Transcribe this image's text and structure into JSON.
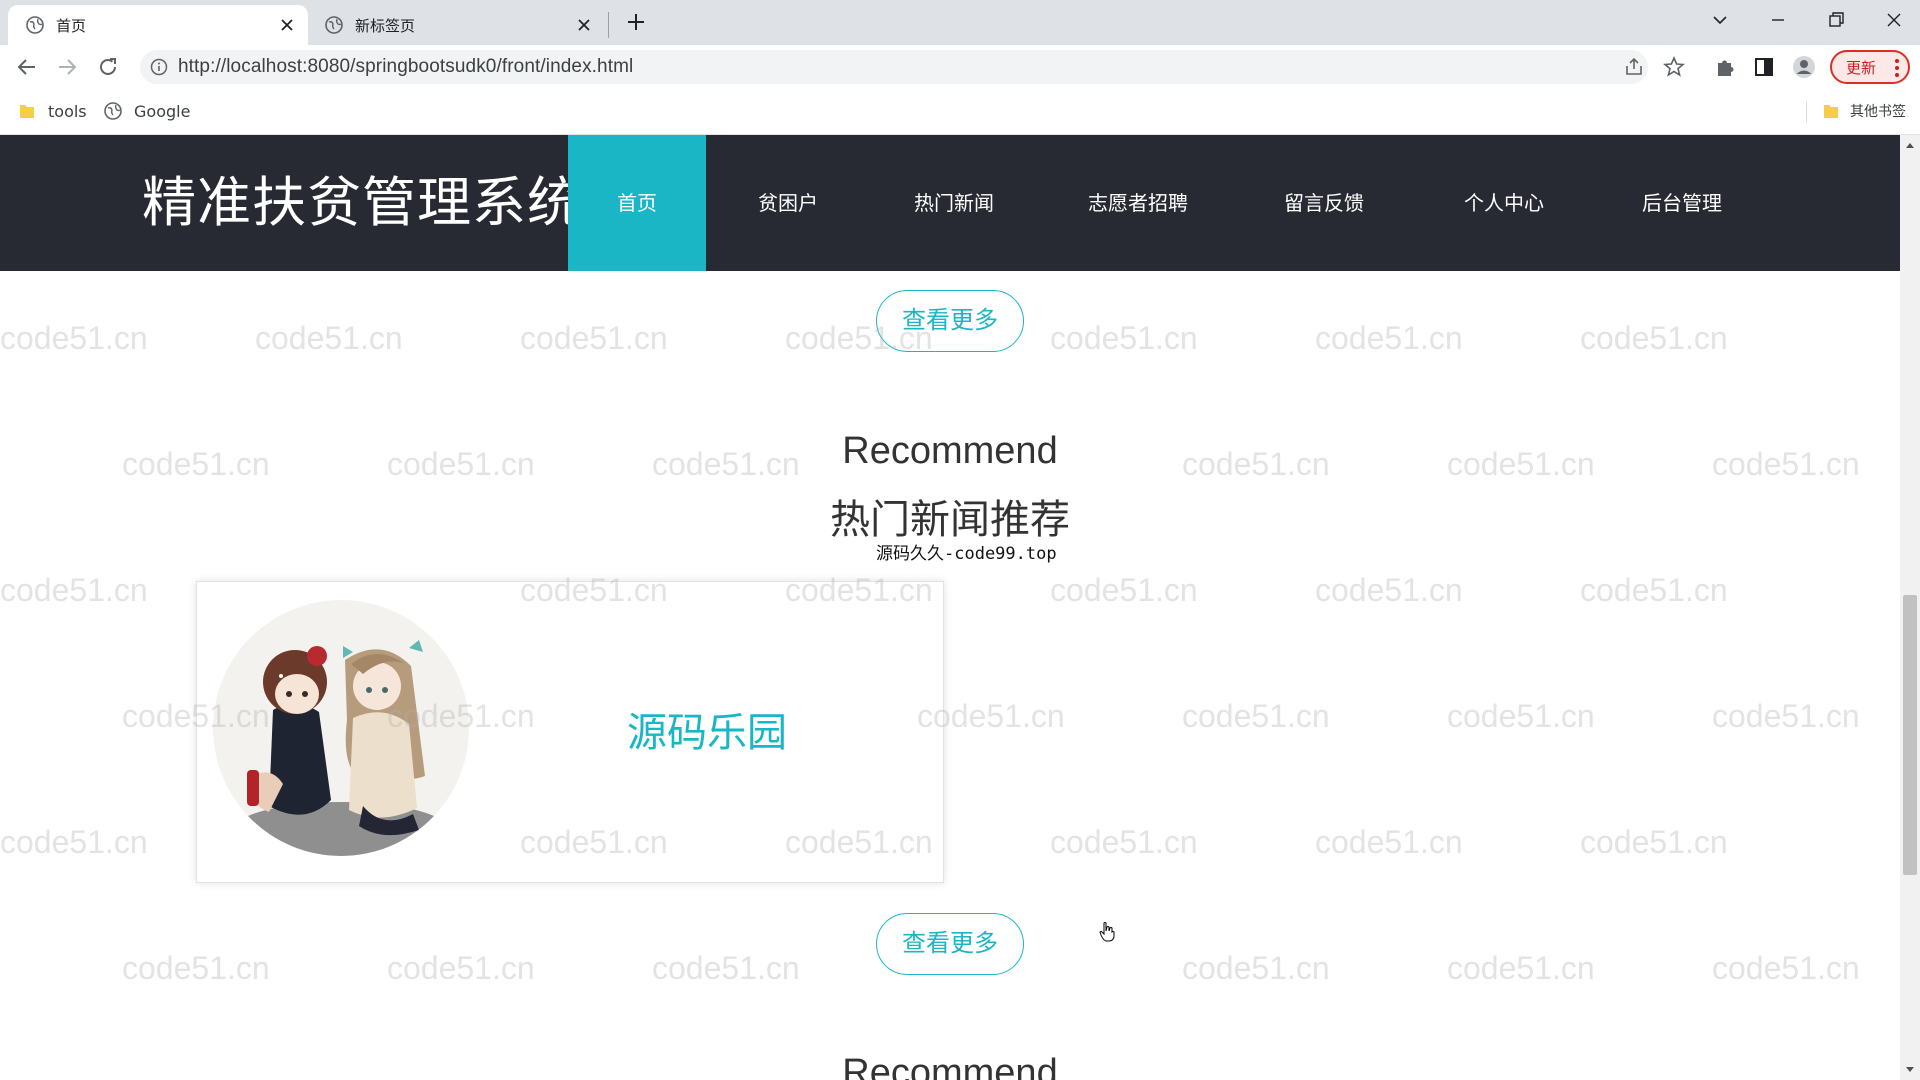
{
  "browser": {
    "tabs": [
      {
        "title": "首页",
        "active": true
      },
      {
        "title": "新标签页",
        "active": false
      }
    ],
    "url": "http://localhost:8080/springbootsudk0/front/index.html",
    "update_label": "更新",
    "bookmarks": [
      {
        "label": "tools",
        "icon": "folder-icon"
      },
      {
        "label": "Google",
        "icon": "globe-icon"
      }
    ],
    "other_bookmarks": "其他书签"
  },
  "site": {
    "title": "精准扶贫管理系统",
    "nav": [
      "首页",
      "贫困户",
      "热门新闻",
      "志愿者招聘",
      "留言反馈",
      "个人中心",
      "后台管理"
    ],
    "active_nav": "首页"
  },
  "content": {
    "more_button": "查看更多",
    "recommend_en": "Recommend",
    "news_section_title": "热门新闻推荐",
    "section_note": "源码久久-code99.top",
    "news_items": [
      {
        "title": "源码乐园"
      }
    ],
    "more_button_2": "查看更多",
    "recommend_en_2": "Recommend"
  },
  "watermark": "code51.cn",
  "colors": {
    "accent": "#1ab6c5",
    "header_bg": "#272a33"
  }
}
